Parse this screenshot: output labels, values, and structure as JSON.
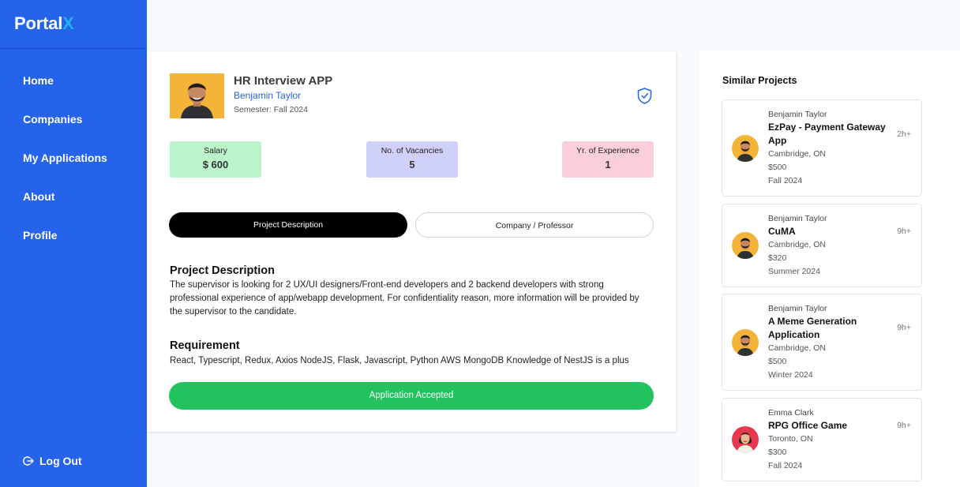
{
  "brand": {
    "name": "Portal",
    "accent": "X"
  },
  "nav": [
    "Home",
    "Companies",
    "My Applications",
    "About",
    "Profile"
  ],
  "logout_label": "Log Out",
  "project": {
    "title": "HR Interview APP",
    "author": "Benjamin Taylor",
    "semester": "Semester: Fall 2024"
  },
  "stats": [
    {
      "label": "Salary",
      "value": "$ 600",
      "color": "#bbf3cb"
    },
    {
      "label": "No. of Vacancies",
      "value": "5",
      "color": "#d0d1fa"
    },
    {
      "label": "Yr. of Experience",
      "value": "1",
      "color": "#fbcfda"
    }
  ],
  "tabs": {
    "active": "Project Description",
    "inactive": "Company / Professor"
  },
  "description": {
    "title": "Project Description",
    "text": "The supervisor is looking for 2 UX/UI designers/Front-end developers and 2 backend developers with strong professional experience of app/webapp development. For confidentiality reason, more information will be provided by the supervisor to the candidate."
  },
  "requirement": {
    "title": "Requirement",
    "text": "React, Typescript, Redux, Axios NodeJS, Flask, Javascript, Python AWS MongoDB Knowledge of NestJS is a plus"
  },
  "status_button": "Application Accepted",
  "similar": {
    "title": "Similar Projects",
    "items": [
      {
        "author": "Benjamin Taylor",
        "title": "EzPay - Payment Gateway App",
        "location": "Cambridge, ON",
        "salary": "$500",
        "term": "Fall 2024",
        "time": "2h+"
      },
      {
        "author": "Benjamin Taylor",
        "title": "CuMA",
        "location": "Cambridge, ON",
        "salary": "$320",
        "term": "Summer 2024",
        "time": "9h+"
      },
      {
        "author": "Benjamin Taylor",
        "title": "A Meme Generation Application",
        "location": "Cambridge, ON",
        "salary": "$500",
        "term": "Winter 2024",
        "time": "9h+"
      },
      {
        "author": "Emma Clark",
        "title": "RPG Office Game",
        "location": "Toronto, ON",
        "salary": "$300",
        "term": "Fall 2024",
        "time": "9h+"
      }
    ]
  },
  "colors": {
    "primary": "#2563eb",
    "success": "#22c35e",
    "logo_accent": "#22b3f5"
  }
}
